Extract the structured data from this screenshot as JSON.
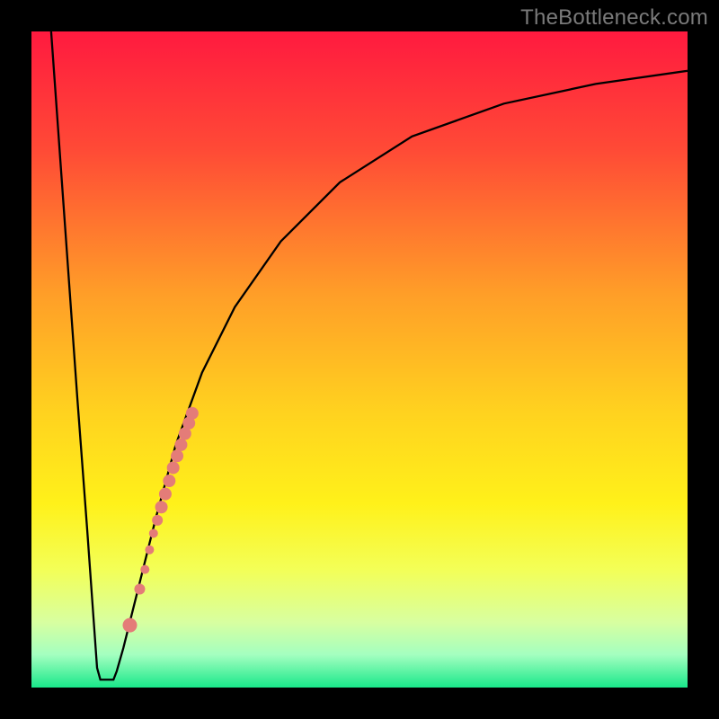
{
  "watermark": "TheBottleneck.com",
  "chart_data": {
    "type": "line",
    "title": "",
    "xlabel": "",
    "ylabel": "",
    "xlim": [
      0,
      100
    ],
    "ylim": [
      0,
      100
    ],
    "grid": false,
    "legend": false,
    "gradient_stops": [
      {
        "pct": 0,
        "color": "#ff1a3f"
      },
      {
        "pct": 18,
        "color": "#ff4a36"
      },
      {
        "pct": 40,
        "color": "#ff9e28"
      },
      {
        "pct": 58,
        "color": "#ffd21f"
      },
      {
        "pct": 72,
        "color": "#fff11a"
      },
      {
        "pct": 82,
        "color": "#f3ff57"
      },
      {
        "pct": 90,
        "color": "#d8ffa0"
      },
      {
        "pct": 95,
        "color": "#a4ffc0"
      },
      {
        "pct": 100,
        "color": "#19e88a"
      }
    ],
    "series": [
      {
        "name": "bottleneck-curve",
        "stroke": "#000000",
        "stroke_width": 2.3,
        "points": [
          {
            "x": 3.0,
            "y": 100.0
          },
          {
            "x": 5.0,
            "y": 72.0
          },
          {
            "x": 7.0,
            "y": 44.0
          },
          {
            "x": 8.5,
            "y": 24.0
          },
          {
            "x": 9.5,
            "y": 10.0
          },
          {
            "x": 10.0,
            "y": 3.0
          },
          {
            "x": 10.5,
            "y": 1.2
          },
          {
            "x": 12.5,
            "y": 1.2
          },
          {
            "x": 13.0,
            "y": 2.5
          },
          {
            "x": 14.0,
            "y": 6.0
          },
          {
            "x": 16.0,
            "y": 14.0
          },
          {
            "x": 19.0,
            "y": 26.0
          },
          {
            "x": 22.0,
            "y": 37.0
          },
          {
            "x": 26.0,
            "y": 48.0
          },
          {
            "x": 31.0,
            "y": 58.0
          },
          {
            "x": 38.0,
            "y": 68.0
          },
          {
            "x": 47.0,
            "y": 77.0
          },
          {
            "x": 58.0,
            "y": 84.0
          },
          {
            "x": 72.0,
            "y": 89.0
          },
          {
            "x": 86.0,
            "y": 92.0
          },
          {
            "x": 100.0,
            "y": 94.0
          }
        ]
      },
      {
        "name": "marker-dots",
        "type": "scatter",
        "fill": "#e47c78",
        "stroke": "none",
        "r_default": 6.5,
        "points": [
          {
            "x": 15.0,
            "y": 9.5,
            "r": 8
          },
          {
            "x": 16.5,
            "y": 15.0,
            "r": 6
          },
          {
            "x": 17.3,
            "y": 18.0,
            "r": 5
          },
          {
            "x": 18.0,
            "y": 21.0,
            "r": 5
          },
          {
            "x": 18.6,
            "y": 23.5,
            "r": 5
          },
          {
            "x": 19.2,
            "y": 25.5,
            "r": 6
          },
          {
            "x": 19.8,
            "y": 27.5,
            "r": 7
          },
          {
            "x": 20.4,
            "y": 29.5,
            "r": 7
          },
          {
            "x": 21.0,
            "y": 31.5,
            "r": 7
          },
          {
            "x": 21.6,
            "y": 33.5,
            "r": 7
          },
          {
            "x": 22.2,
            "y": 35.3,
            "r": 7
          },
          {
            "x": 22.8,
            "y": 37.0,
            "r": 7
          },
          {
            "x": 23.4,
            "y": 38.7,
            "r": 7
          },
          {
            "x": 24.0,
            "y": 40.3,
            "r": 7
          },
          {
            "x": 24.5,
            "y": 41.8,
            "r": 7
          }
        ]
      }
    ]
  }
}
